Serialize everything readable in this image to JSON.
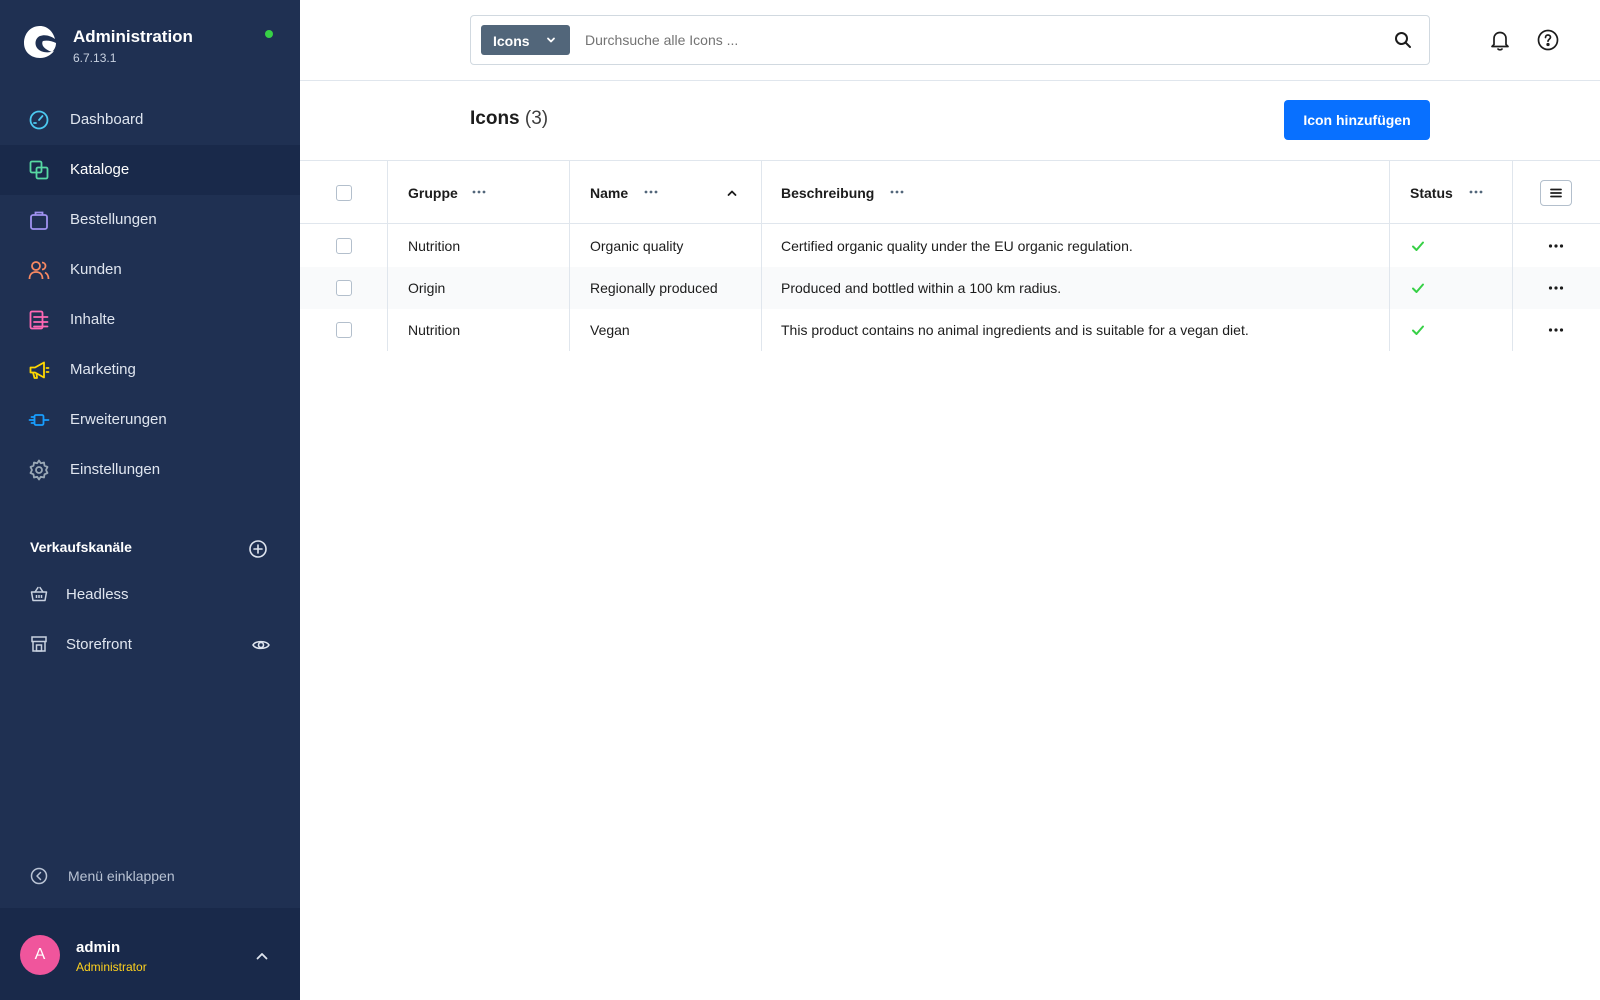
{
  "app": {
    "title": "Administration",
    "version": "6.7.13.1",
    "status_color": "#37d046",
    "logo_icon": "shopware-logo-icon"
  },
  "sidebar": {
    "items": [
      {
        "label": "Dashboard",
        "icon": "dashboard-gauge-icon",
        "color": "#4cc9f0",
        "active": false
      },
      {
        "label": "Kataloge",
        "icon": "catalog-icon",
        "color": "#57d9a3",
        "active": true
      },
      {
        "label": "Bestellungen",
        "icon": "shopping-bag-icon",
        "color": "#a092f0",
        "active": false
      },
      {
        "label": "Kunden",
        "icon": "customers-icon",
        "color": "#f88962",
        "active": false
      },
      {
        "label": "Inhalte",
        "icon": "content-icon",
        "color": "#ff68b4",
        "active": false
      },
      {
        "label": "Marketing",
        "icon": "megaphone-icon",
        "color": "#ffd700",
        "active": false
      },
      {
        "label": "Erweiterungen",
        "icon": "plug-icon",
        "color": "#189eff",
        "active": false
      },
      {
        "label": "Einstellungen",
        "icon": "gear-icon",
        "color": "#9aa8b5",
        "active": false
      }
    ],
    "sales_channels_title": "Verkaufskanäle",
    "channels": [
      {
        "label": "Headless",
        "icon": "basket-icon"
      },
      {
        "label": "Storefront",
        "icon": "storefront-icon"
      }
    ],
    "collapse_label": "Menü einklappen"
  },
  "user": {
    "initial": "A",
    "name": "admin",
    "role": "Administrator",
    "avatar_color": "#f0559c"
  },
  "search": {
    "type_label": "Icons",
    "placeholder": "Durchsuche alle Icons ...",
    "value": ""
  },
  "page": {
    "title": "Icons",
    "count": "(3)",
    "add_button": "Icon hinzufügen",
    "accent_color": "#0870ff"
  },
  "grid": {
    "columns": [
      {
        "label": "Gruppe"
      },
      {
        "label": "Name",
        "sort": "ascending"
      },
      {
        "label": "Beschreibung"
      },
      {
        "label": "Status"
      }
    ],
    "rows": [
      {
        "group": "Nutrition",
        "name": "Organic quality",
        "description": "Certified organic quality under the EU organic regulation.",
        "status": true
      },
      {
        "group": "Origin",
        "name": "Regionally produced",
        "description": "Produced and bottled within a 100 km radius.",
        "status": true
      },
      {
        "group": "Nutrition",
        "name": "Vegan",
        "description": "This product contains no animal ingredients and is suitable for a vegan diet.",
        "status": true
      }
    ]
  }
}
